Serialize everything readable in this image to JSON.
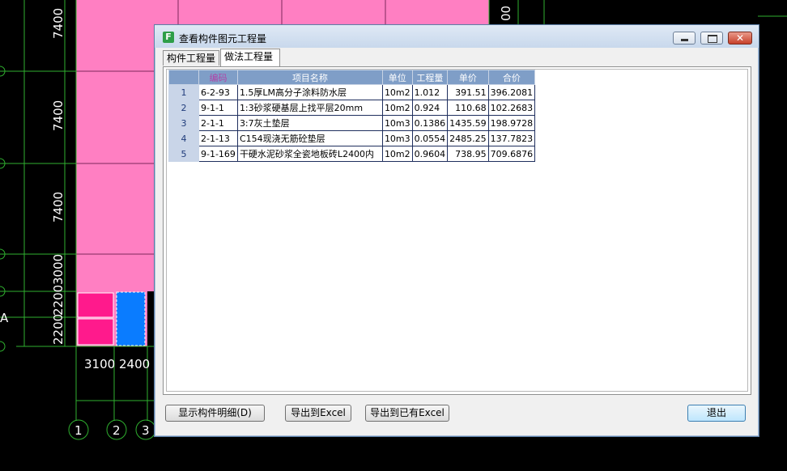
{
  "cad": {
    "left_dims": [
      "7400",
      "7400",
      "7400",
      "2200",
      "3000",
      "2200"
    ],
    "top_right_dim": "00",
    "bottom_dims": [
      "3100",
      "2400"
    ],
    "axis_bubbles": [
      "1",
      "2",
      "3"
    ],
    "side_letter": "A",
    "colors": {
      "pink": "#ff7fc2",
      "magenta": "#ff1a8c",
      "blue": "#0a7cff",
      "green": "#2fb02f"
    }
  },
  "dialog": {
    "title": "查看构件图元工程量",
    "app_icon_glyph": "F",
    "close_glyph": "✕",
    "tabs": [
      "构件工程量",
      "做法工程量"
    ],
    "active_tab": "做法工程量",
    "table": {
      "headers": [
        "编码",
        "项目名称",
        "单位",
        "工程量",
        "单价",
        "合价"
      ],
      "rows": [
        [
          "1",
          "6-2-93",
          "1.5厚LM高分子涂料防水层",
          "10m2",
          "1.012",
          "391.51",
          "396.2081"
        ],
        [
          "2",
          "9-1-1",
          "1:3砂浆硬基层上找平层20mm",
          "10m2",
          "0.924",
          "110.68",
          "102.2683"
        ],
        [
          "3",
          "2-1-1",
          "3:7灰土垫层",
          "10m3",
          "0.1386",
          "1435.59",
          "198.9728"
        ],
        [
          "4",
          "2-1-13",
          "C154现浇无筋砼垫层",
          "10m3",
          "0.0554",
          "2485.25",
          "137.7823"
        ],
        [
          "5",
          "9-1-169",
          "干硬水泥砂浆全瓷地板砖L2400内",
          "10m2",
          "0.9604",
          "738.95",
          "709.6876"
        ]
      ]
    },
    "buttons": {
      "show_detail": "显示构件明细(D)",
      "export_excel": "导出到Excel",
      "export_existing_excel": "导出到已有Excel",
      "exit": "退出"
    }
  }
}
